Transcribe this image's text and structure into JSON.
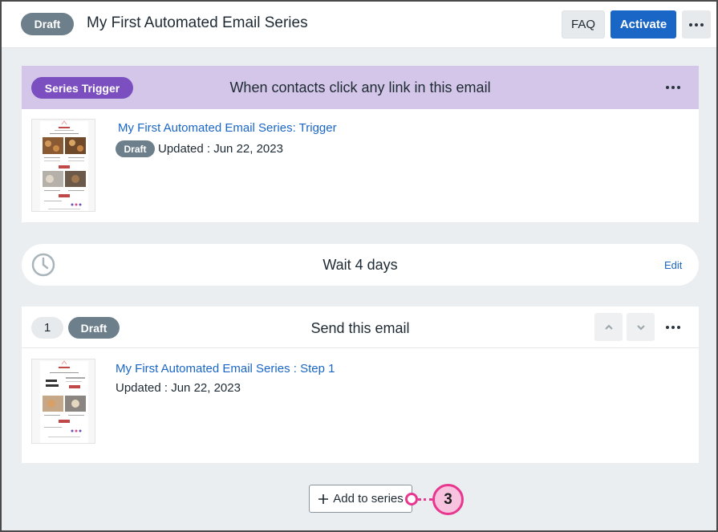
{
  "header": {
    "status": "Draft",
    "title": "My First Automated Email Series",
    "faq_label": "FAQ",
    "activate_label": "Activate"
  },
  "trigger": {
    "badge": "Series Trigger",
    "title": "When contacts click any link in this email",
    "email_name": "My First Automated Email Series: Trigger",
    "email_status": "Draft",
    "updated": "Updated : Jun 22, 2023"
  },
  "wait": {
    "text": "Wait 4 days",
    "edit_label": "Edit"
  },
  "step": {
    "number": "1",
    "status": "Draft",
    "title": "Send this email",
    "email_name": "My First Automated Email Series : Step 1",
    "updated": "Updated : Jun 22, 2023"
  },
  "add_button": {
    "label": "Add to series"
  },
  "callout": {
    "number": "3"
  },
  "colors": {
    "accent_blue": "#1a66c6",
    "trigger_purple": "#7b4fbf",
    "trigger_header": "#d3c6e8",
    "status_gray": "#6d7f8b",
    "callout_pink": "#e7378e"
  }
}
